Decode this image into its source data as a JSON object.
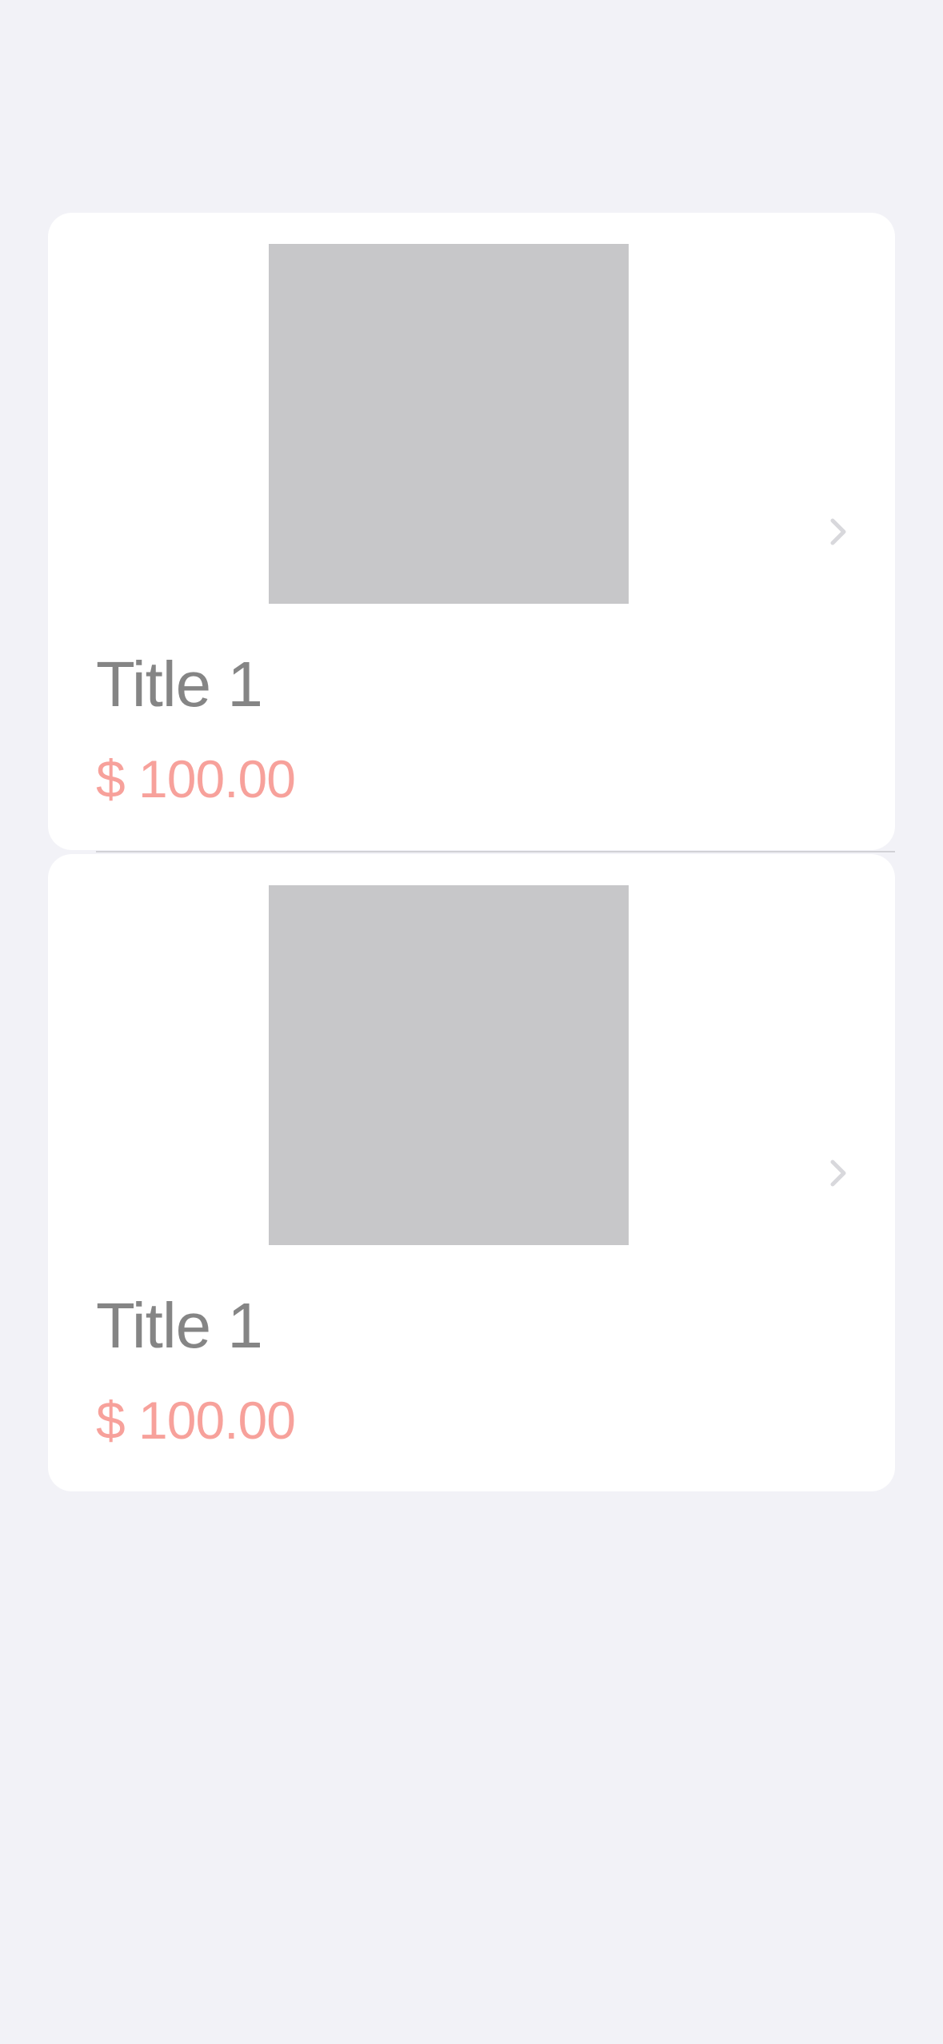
{
  "items": [
    {
      "title": "Title 1",
      "price": "$ 100.00",
      "icon": "chevron-right-icon"
    },
    {
      "title": "Title 1",
      "price": "$ 100.00",
      "icon": "chevron-right-icon"
    }
  ],
  "colors": {
    "background": "#f2f2f7",
    "card": "#ffffff",
    "placeholder": "#c7c7c9",
    "title": "#858585",
    "price": "#f7a19b"
  }
}
